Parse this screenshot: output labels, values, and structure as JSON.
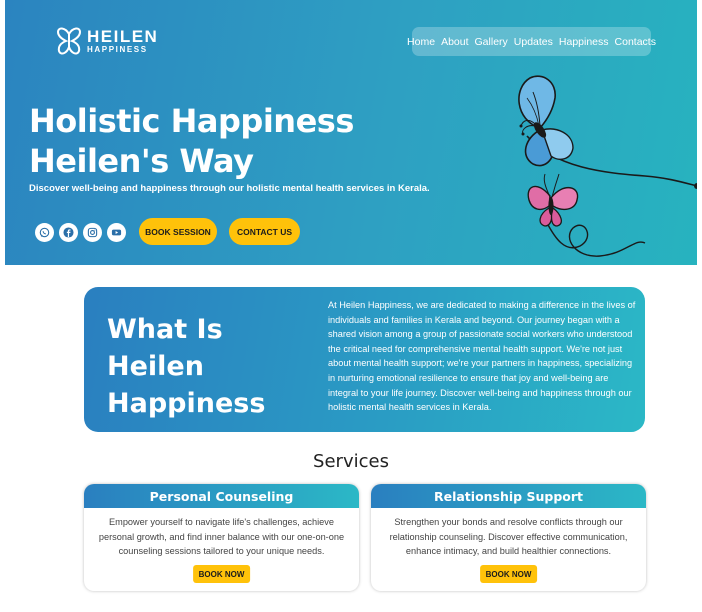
{
  "brand": {
    "name": "HEILEN",
    "tagline": "HAPPINESS"
  },
  "nav": [
    "Home",
    "About",
    "Gallery",
    "Updates",
    "Happiness",
    "Contacts"
  ],
  "hero": {
    "title_line1": "Holistic Happiness",
    "title_line2": "Heilen's Way",
    "subtitle": "Discover well-being and happiness through our holistic mental health services in Kerala.",
    "socials": [
      "whatsapp-icon",
      "facebook-icon",
      "instagram-icon",
      "youtube-icon"
    ],
    "book_label": "BOOK SESSION",
    "contact_label": "CONTACT US"
  },
  "about": {
    "title_line1": "What Is",
    "title_line2": "Heilen",
    "title_line3": "Happiness",
    "text": "At Heilen Happiness, we are dedicated to making a difference in the lives of individuals and families in Kerala and beyond. Our journey began with a shared vision among a group of passionate social workers who understood the critical need for comprehensive mental health support. We're not just about mental health support; we're your partners in happiness, specializing in nurturing emotional resilience to ensure that joy and well-being are integral to your life journey. Discover well-being and happiness through our holistic mental health services in Kerala."
  },
  "services": {
    "heading": "Services",
    "cards": [
      {
        "title": "Personal Counseling",
        "text": "Empower yourself to navigate life's challenges, achieve personal growth, and find inner balance with our one-on-one counseling sessions tailored to your unique needs.",
        "button": "BOOK NOW"
      },
      {
        "title": "Relationship Support",
        "text": "Strengthen your bonds and resolve conflicts through our relationship counseling. Discover effective communication, enhance intimacy, and build healthier connections.",
        "button": "BOOK NOW"
      }
    ]
  },
  "colors": {
    "accent": "#ffc20a",
    "hero_start": "#2b84c0",
    "hero_end": "#27b3bf"
  }
}
